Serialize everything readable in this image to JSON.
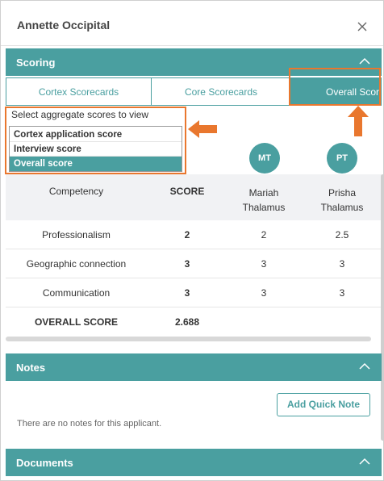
{
  "header": {
    "title": "Annette Occipital",
    "close_icon": "close-icon"
  },
  "scoring": {
    "section_label": "Scoring",
    "tabs": [
      {
        "label": "Cortex Scorecards",
        "active": false
      },
      {
        "label": "Core Scorecards",
        "active": false
      },
      {
        "label": "Overall Score",
        "active": true
      }
    ],
    "aggregate_label": "Select aggregate scores to view",
    "aggregate_options": [
      {
        "label": "Cortex application score",
        "selected": false
      },
      {
        "label": "Interview score",
        "selected": false
      },
      {
        "label": "Overall score",
        "selected": true
      }
    ],
    "reviewers": [
      {
        "initials": "MT",
        "name_line1": "Mariah",
        "name_line2": "Thalamus"
      },
      {
        "initials": "PT",
        "name_line1": "Prisha",
        "name_line2": "Thalamus"
      }
    ],
    "table": {
      "col_competency": "Competency",
      "col_score": "SCORE",
      "rows": [
        {
          "competency": "Professionalism",
          "score": "2",
          "r1": "2",
          "r2": "2.5"
        },
        {
          "competency": "Geographic connection",
          "score": "3",
          "r1": "3",
          "r2": "3"
        },
        {
          "competency": "Communication",
          "score": "3",
          "r1": "3",
          "r2": "3"
        }
      ],
      "overall_label": "OVERALL SCORE",
      "overall_score": "2.688"
    }
  },
  "notes": {
    "section_label": "Notes",
    "add_button": "Add Quick Note",
    "empty_text": "There are no notes for this applicant."
  },
  "documents": {
    "section_label": "Documents"
  },
  "colors": {
    "accent": "#4a9fa0",
    "highlight": "#e9772e"
  }
}
